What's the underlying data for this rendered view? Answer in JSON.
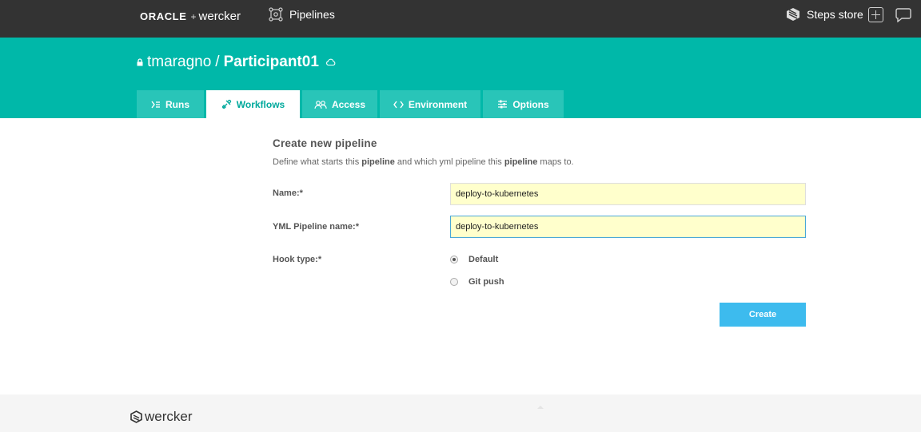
{
  "topbar": {
    "brand_oracle": "ORACLE",
    "brand_plus": "+",
    "brand_wercker": "wercker",
    "nav_pipelines": "Pipelines",
    "steps_store": "Steps store",
    "icons": [
      "pipelines-icon",
      "steps-store-icon",
      "add-icon",
      "chat-icon"
    ]
  },
  "header": {
    "owner": "tmaragno",
    "separator": "/",
    "repo": "Participant01",
    "tabs": [
      {
        "label": "Runs",
        "icon": "runs-icon",
        "active": false
      },
      {
        "label": "Workflows",
        "icon": "workflows-icon",
        "active": true
      },
      {
        "label": "Access",
        "icon": "access-icon",
        "active": false
      },
      {
        "label": "Environment",
        "icon": "code-icon",
        "active": false
      },
      {
        "label": "Options",
        "icon": "sliders-icon",
        "active": false
      }
    ]
  },
  "form": {
    "title": "Create new pipeline",
    "desc_part1": "Define what starts this ",
    "desc_bold1": "pipeline",
    "desc_part2": " and which yml pipeline this ",
    "desc_bold2": "pipeline",
    "desc_part3": " maps to.",
    "name_label": "Name:*",
    "name_value": "deploy-to-kubernetes",
    "yml_label": "YML Pipeline name:*",
    "yml_value": "deploy-to-kubernetes",
    "hook_label": "Hook type:*",
    "hook_options": [
      {
        "label": "Default",
        "checked": true
      },
      {
        "label": "Git push",
        "checked": false
      }
    ],
    "create_label": "Create"
  },
  "footer": {
    "logo_text": "wercker"
  },
  "colors": {
    "topbar": "#333333",
    "teal": "#00b8a9",
    "tab_inactive": "#29c5b8",
    "input_bg": "#ffffcc",
    "button": "#3dbbee"
  }
}
